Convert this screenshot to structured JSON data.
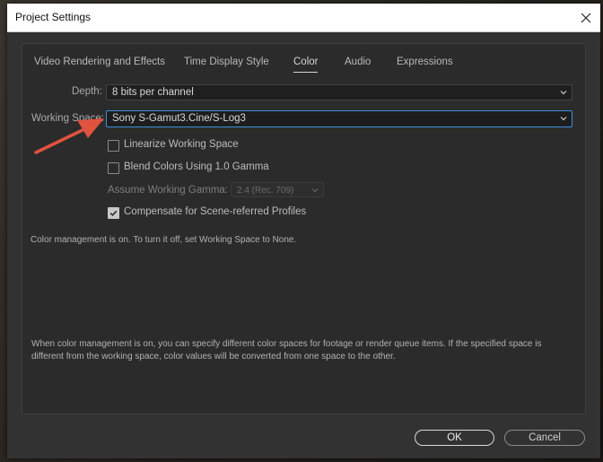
{
  "window": {
    "title": "Project Settings"
  },
  "tabs": [
    {
      "label": "Video Rendering and Effects"
    },
    {
      "label": "Time Display Style"
    },
    {
      "label": "Color"
    },
    {
      "label": "Audio"
    },
    {
      "label": "Expressions"
    }
  ],
  "color": {
    "depth_label": "Depth:",
    "depth_value": "8 bits per channel",
    "working_space_label": "Working Space:",
    "working_space_value": "Sony S-Gamut3.Cine/S-Log3",
    "linearize_label": "Linearize Working Space",
    "linearize_checked": false,
    "blend_label": "Blend Colors Using 1.0 Gamma",
    "blend_checked": false,
    "gamma_label": "Assume Working Gamma:",
    "gamma_value": "2.4 (Rec. 709)",
    "compensate_label": "Compensate for Scene-referred Profiles",
    "compensate_checked": true,
    "status_text": "Color management is on. To turn it off, set Working Space to None.",
    "help_line1": "When color management is on, you can specify different color spaces for footage or render queue items. If the specified space is",
    "help_line2": "different from the working space, color values will be converted from one space to the other."
  },
  "buttons": {
    "ok": "OK",
    "cancel": "Cancel"
  },
  "annotation": {
    "arrow_color": "#e0533f"
  },
  "icons": [
    "close-icon",
    "chevron-down-icon",
    "checkmark-icon",
    "arrow-annotation-icon"
  ]
}
